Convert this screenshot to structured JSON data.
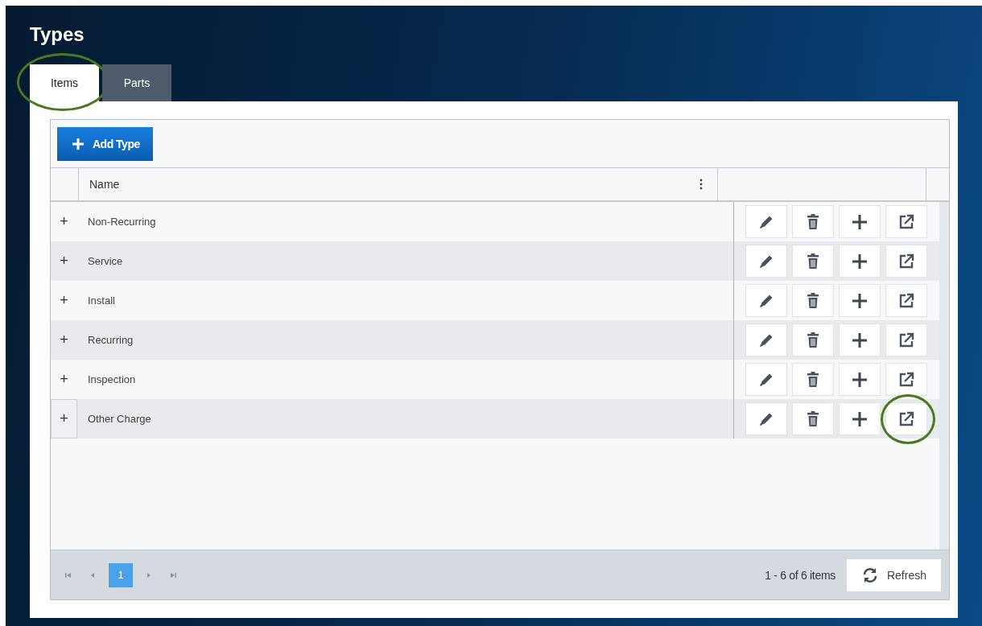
{
  "page_title": "Types",
  "tabs": [
    {
      "label": "Items",
      "selected": true,
      "highlighted": true
    },
    {
      "label": "Parts",
      "selected": false,
      "highlighted": false
    }
  ],
  "toolbar": {
    "add_button": "Add Type"
  },
  "table": {
    "columns": [
      "Name"
    ],
    "rows": [
      {
        "expand": "+",
        "name": "Non-Recurring",
        "focused": false,
        "highlighted": false
      },
      {
        "expand": "+",
        "name": "Service",
        "focused": false,
        "highlighted": false
      },
      {
        "expand": "+",
        "name": "Install",
        "focused": false,
        "highlighted": false
      },
      {
        "expand": "+",
        "name": "Recurring",
        "focused": false,
        "highlighted": false
      },
      {
        "expand": "+",
        "name": "Inspection",
        "focused": false,
        "highlighted": false
      },
      {
        "expand": "+",
        "name": "Other Charge",
        "focused": true,
        "highlighted": true
      }
    ]
  },
  "pager": {
    "pages": [
      {
        "label": "1",
        "selected": true
      }
    ],
    "summary": "1 - 6 of 6 items",
    "refresh": "Refresh"
  }
}
